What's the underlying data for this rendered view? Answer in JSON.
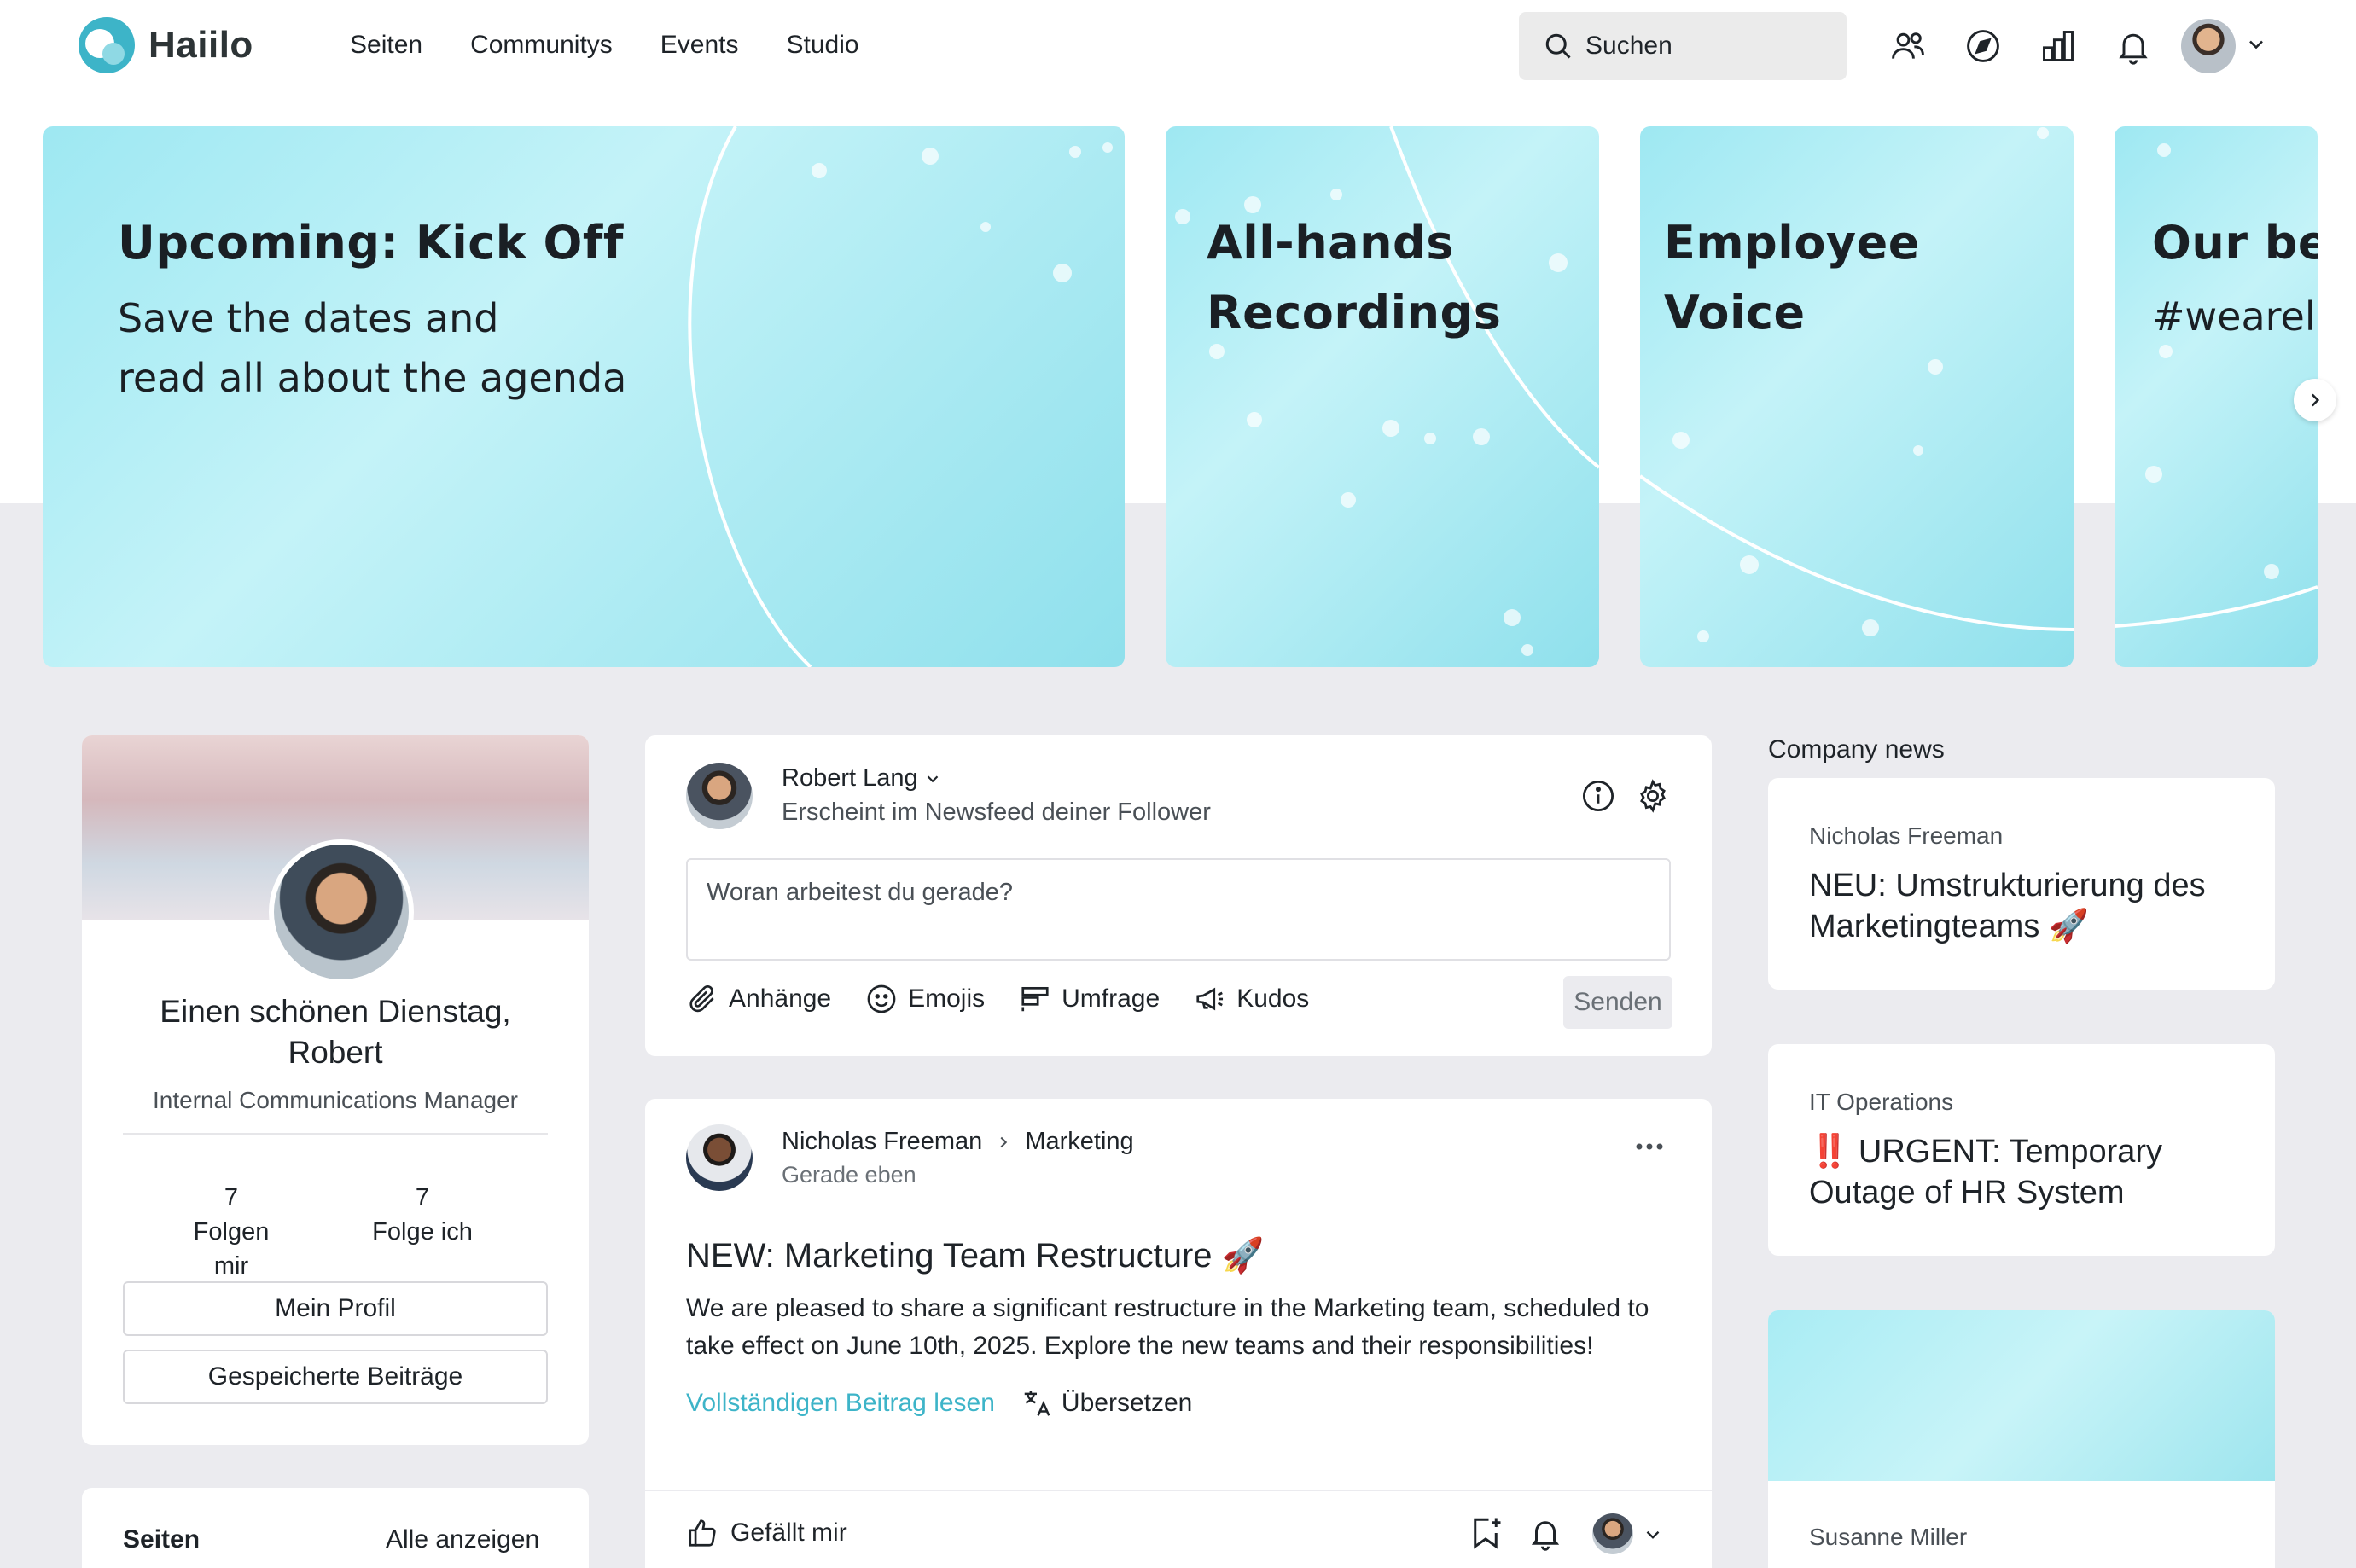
{
  "header": {
    "logo_text": "Haiilo",
    "nav": [
      "Seiten",
      "Communitys",
      "Events",
      "Studio"
    ],
    "search_label": "Suchen",
    "accent_color": "#3db4c8"
  },
  "banners": [
    {
      "title_lines": [
        "Upcoming: Kick Off"
      ],
      "subtitle_lines": [
        "Save the dates and",
        "read all about the agenda"
      ]
    },
    {
      "title_lines": [
        "All-hands",
        "Recordings"
      ]
    },
    {
      "title_lines": [
        "Employee",
        "Voice"
      ]
    },
    {
      "title_lines": [
        "Our be"
      ],
      "subtitle_lines": [
        "#wearel"
      ]
    }
  ],
  "profile": {
    "greeting": "Einen schönen Dienstag, Robert",
    "job_title": "Internal Communications Manager",
    "followers_count": "7",
    "followers_label": "Folgen mir",
    "following_count": "7",
    "following_label": "Folge ich",
    "my_profile_button": "Mein Profil",
    "saved_posts_button": "Gespeicherte Beiträge"
  },
  "pages_card": {
    "title": "Seiten",
    "show_all": "Alle anzeigen"
  },
  "composer": {
    "author": "Robert Lang",
    "visibility_hint": "Erscheint im Newsfeed deiner Follower",
    "placeholder": "Woran arbeitest du gerade?",
    "actions": [
      "Anhänge",
      "Emojis",
      "Umfrage",
      "Kudos"
    ],
    "send_label": "Senden"
  },
  "post": {
    "author": "Nicholas Freeman",
    "target": "Marketing",
    "time": "Gerade eben",
    "title": "NEW: Marketing Team Restructure 🚀",
    "body": "We are pleased to share a significant restructure in the Marketing team, scheduled to take effect on June 10th, 2025. Explore the new teams and their responsibilities!",
    "read_more": "Vollständigen Beitrag lesen",
    "translate": "Übersetzen",
    "like": "Gefällt mir"
  },
  "company_news": {
    "title": "Company news",
    "items": [
      {
        "author": "Nicholas Freeman",
        "title": "NEU: Umstrukturierung des Marketingteams 🚀"
      },
      {
        "author": "IT Operations",
        "title": "‼️ URGENT: Temporary Outage of HR System"
      },
      {
        "author": "Susanne Miller",
        "title": ""
      }
    ]
  }
}
